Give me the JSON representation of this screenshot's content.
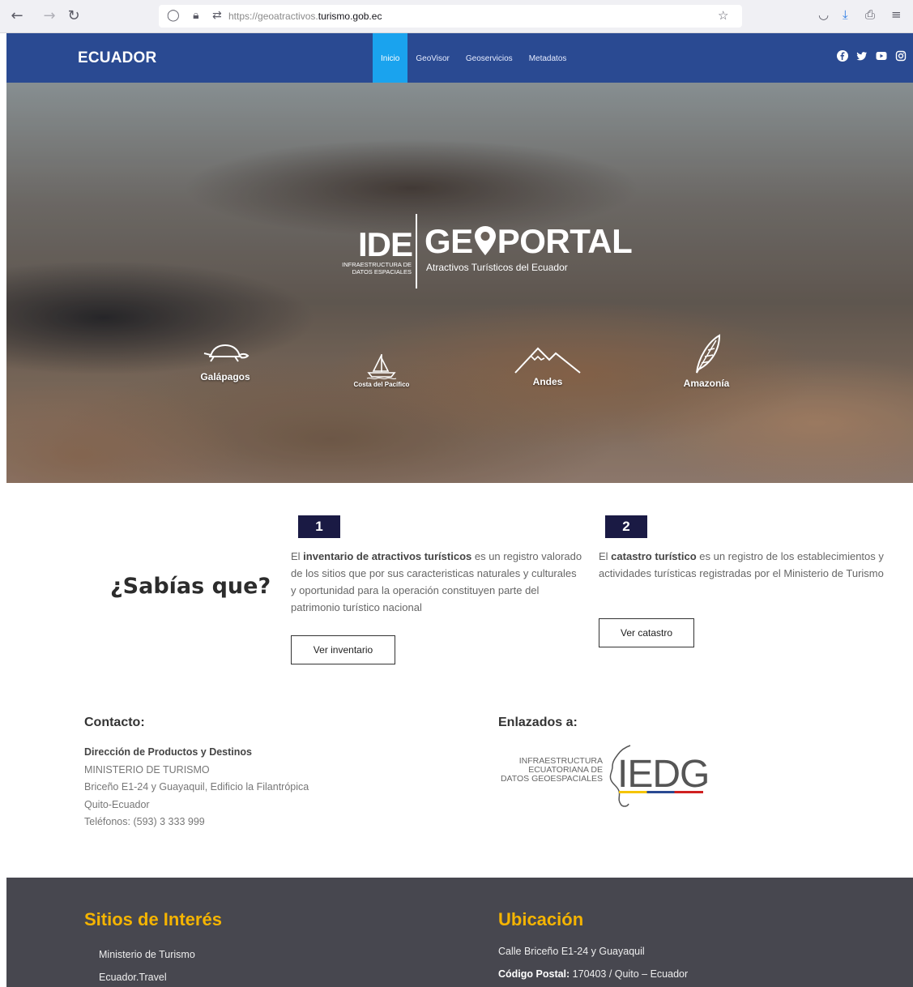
{
  "browser": {
    "url_prefix": "https://geoatractivos.",
    "url_domain": "turismo.gob.ec"
  },
  "nav": {
    "brand": "ECUADOR",
    "items": [
      {
        "label": "Inicio"
      },
      {
        "label": "GeoVisor"
      },
      {
        "label": "Geoservicios"
      },
      {
        "label": "Metadatos"
      }
    ]
  },
  "hero": {
    "logo_ide": "IDE",
    "logo_ide_sub": "INFRAESTRUCTURA DE DATOS ESPACIALES",
    "logo_geo": "GE",
    "logo_portal": "PORTAL",
    "logo_sub": "Atractivos Turísticos del Ecuador",
    "regions": [
      {
        "label": "Galápagos",
        "icon": "turtle-icon"
      },
      {
        "label": "Costa del Pacífico",
        "icon": "sailboat-icon"
      },
      {
        "label": "Andes",
        "icon": "mountains-icon"
      },
      {
        "label": "Amazonía",
        "icon": "leaf-icon"
      }
    ]
  },
  "info": {
    "heading": "¿Sabías que?",
    "card1": {
      "number": "1",
      "text_pre": "El ",
      "text_bold": "inventario de atractivos turísticos",
      "text_post": " es un registro valorado de los sitios que por sus caracteristicas naturales y culturales y oportunidad para la operación constituyen parte del patrimonio turístico nacional",
      "button": "Ver inventario"
    },
    "card2": {
      "number": "2",
      "text_pre": "El ",
      "text_bold": "catastro turístico",
      "text_post": " es un registro de los establecimientos y actividades turísticas registradas por el Ministerio de Turismo",
      "button": "Ver catastro"
    }
  },
  "contact": {
    "heading": "Contacto:",
    "lines": [
      "Dirección de Productos y Destinos",
      "MINISTERIO DE TURISMO",
      "Briceño E1-24 y Guayaquil, Edificio la Filantrópica",
      "Quito-Ecuador",
      "Teléfonos: (593) 3 333 999"
    ]
  },
  "linked": {
    "heading": "Enlazados a:",
    "logo_text_1": "INFRAESTRUCTURA",
    "logo_text_2": "ECUATORIANA DE",
    "logo_text_3": "DATOS GEOESPACIALES",
    "logo_big": "IEDG"
  },
  "footer": {
    "sites_heading": "Sitios de Interés",
    "sites": [
      "Ministerio de Turismo",
      "Ecuador.Travel"
    ],
    "location_heading": "Ubicación",
    "address": "Calle Briceño E1-24 y Guayaquil",
    "postal_label": "Código Postal:",
    "postal_value": " 170403 / Quito – Ecuador"
  },
  "colors": {
    "nav_bg": "#2a4a92",
    "nav_active": "#1aa3ee",
    "badge_bg": "#1a1a44",
    "footer_bg": "#47474f",
    "footer_heading": "#f5b400"
  }
}
